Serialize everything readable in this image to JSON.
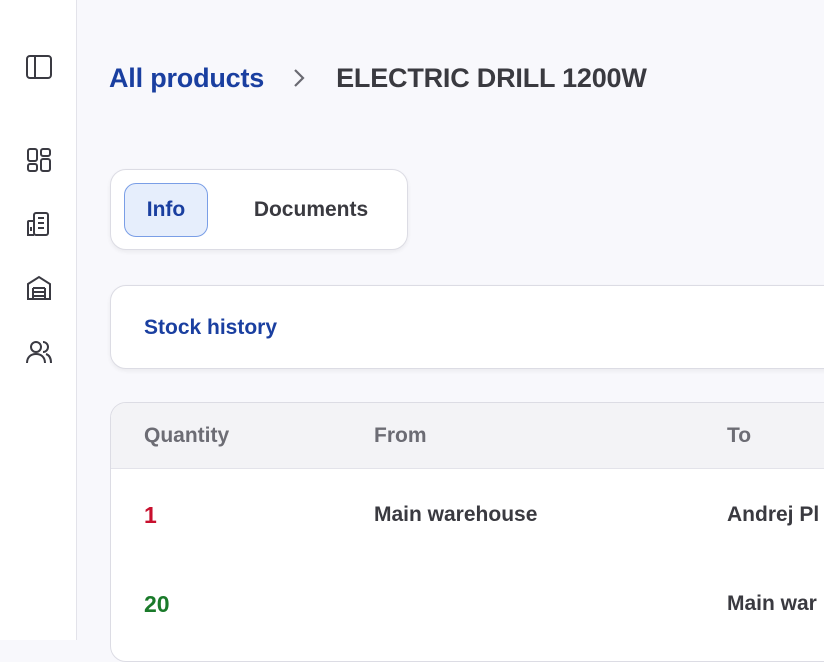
{
  "sidebar": {
    "icons": [
      "sidebar-toggle-icon",
      "dashboard-icon",
      "building-icon",
      "warehouse-icon",
      "users-icon"
    ]
  },
  "breadcrumb": {
    "parent": "All products",
    "current": "ELECTRIC DRILL 1200W"
  },
  "tabs": [
    {
      "label": "Info",
      "active": true
    },
    {
      "label": "Documents",
      "active": false
    }
  ],
  "stock_section": {
    "title": "Stock history"
  },
  "table": {
    "columns": [
      "Quantity",
      "From",
      "To"
    ],
    "rows": [
      {
        "quantity": "1",
        "quantity_color": "#c8102e",
        "from": "Main warehouse",
        "to": "Andrej Pl"
      },
      {
        "quantity": "20",
        "quantity_color": "#1a7a2a",
        "from": "",
        "to": "Main war"
      }
    ]
  },
  "colors": {
    "accent": "#1a3fa0",
    "negative": "#c8102e",
    "positive": "#1a7a2a"
  }
}
